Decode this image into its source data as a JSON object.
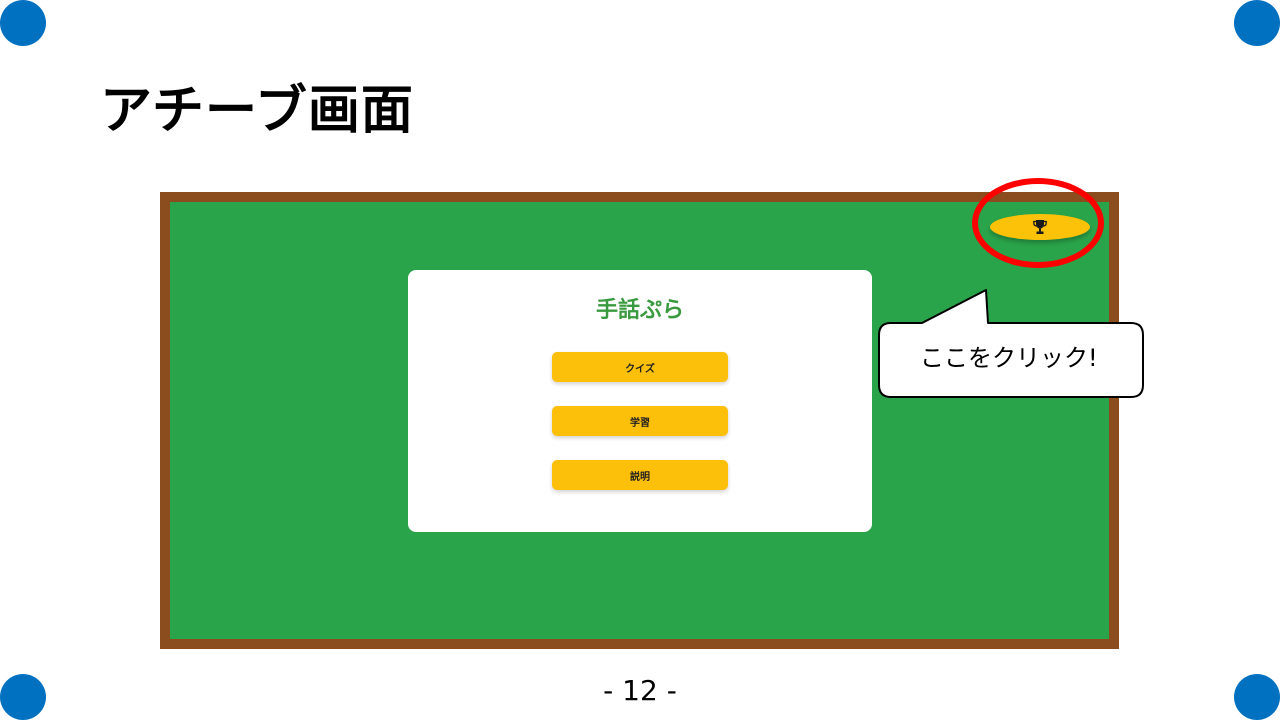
{
  "slide": {
    "title": "アチーブ画面",
    "page_number": "- 12 -"
  },
  "app": {
    "title": "手話ぷら",
    "buttons": [
      "クイズ",
      "学習",
      "説明"
    ],
    "achievement_button_icon": "trophy-icon"
  },
  "callout": {
    "text": "ここをクリック!"
  },
  "colors": {
    "corner_dots": "#0070c0",
    "board_frame": "#8b4d1e",
    "board_background": "#2aa44a",
    "app_title": "#3a9a3f",
    "menu_button": "#fcbf0a",
    "trophy_button": "#fcc20a",
    "highlight_ring": "#ff0000"
  }
}
